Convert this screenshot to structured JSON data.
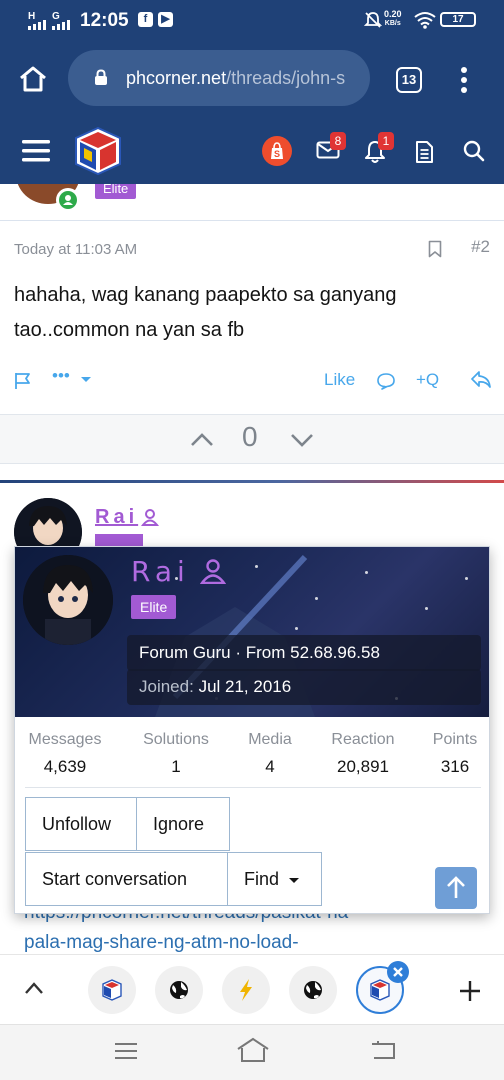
{
  "status_bar": {
    "signal1": "H",
    "signal2": "G",
    "time": "12:05",
    "net_speed_value": "0.20",
    "net_speed_unit": "KB/s",
    "battery": "17"
  },
  "browser": {
    "url_domain": "phcorner.net",
    "url_path": "/threads/john-s",
    "tab_count": "13"
  },
  "site_header": {
    "inbox_badge": "8",
    "alerts_badge": "1"
  },
  "post_prev": {
    "rank": "Elite",
    "timestamp": "Today at 11:03 AM",
    "post_number": "#2",
    "body": "hahaha, wag kanang paapekto sa ganyang tao..common na yan sa fb",
    "actions": {
      "more": "•••",
      "like": "Like",
      "quote": "+Q"
    },
    "vote_score": "0"
  },
  "post_next": {
    "username": "Rai"
  },
  "member_card": {
    "username": "Rai",
    "rank": "Elite",
    "title_line": "Forum Guru · From 52.68.96.58",
    "joined_label": "Joined:",
    "joined_date": "Jul 21, 2016",
    "stats": [
      {
        "label": "Messages",
        "value": "4,639"
      },
      {
        "label": "Solutions",
        "value": "1"
      },
      {
        "label": "Media",
        "value": "4"
      },
      {
        "label": "Reaction",
        "value": "20,891"
      },
      {
        "label": "Points",
        "value": "316"
      }
    ],
    "buttons": {
      "unfollow": "Unfollow",
      "ignore": "Ignore",
      "start_conversation": "Start conversation",
      "find": "Find"
    }
  },
  "link_lines": [
    "https://phcorner.net/threads/pasikat-na-",
    "pala-mag-share-ng-atm-no-load-"
  ],
  "colors": {
    "brand": "#1f4177",
    "accent_link": "#47a7eb",
    "rank_purple": "#a25ad3",
    "badge_red": "#e03434"
  }
}
